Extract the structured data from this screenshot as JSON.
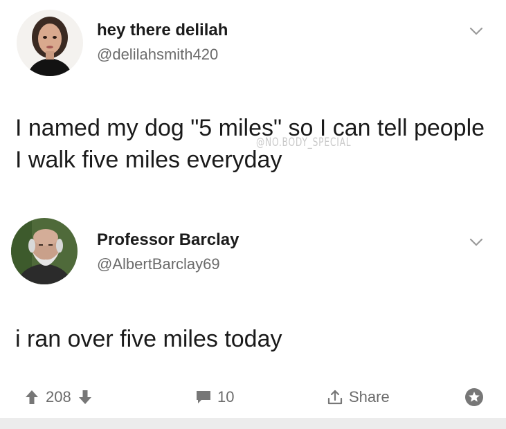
{
  "posts": [
    {
      "display_name": "hey there delilah",
      "handle": "@delilahsmith420",
      "text": "I named my dog \"5 miles\" so I can tell people I walk five miles everyday",
      "watermark": "@NO.BODY_SPECIAL"
    },
    {
      "display_name": "Professor Barclay",
      "handle": "@AlbertBarclay69",
      "text": "i ran over five miles today"
    }
  ],
  "actions": {
    "upvotes": "208",
    "comments": "10",
    "share_label": "Share"
  },
  "icons": {
    "upvote": "arrow-up-icon",
    "downvote": "arrow-down-icon",
    "comment": "comment-bubble-icon",
    "share": "share-icon",
    "award": "award-icon",
    "menu": "chevron-down-icon"
  },
  "colors": {
    "name": "#1b1b1b",
    "handle": "#6b6b6b",
    "icons": "#777777"
  }
}
